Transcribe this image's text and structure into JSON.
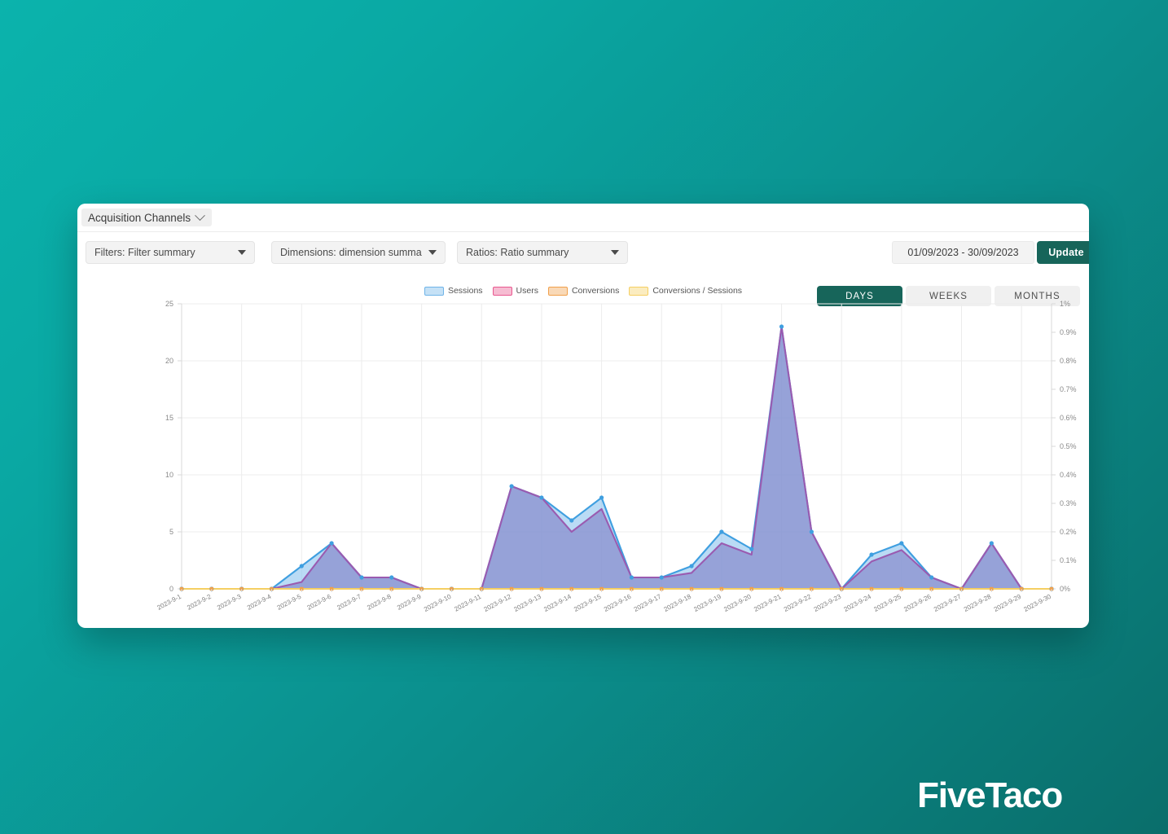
{
  "brand": {
    "name": "FiveTaco"
  },
  "card": {
    "title": "Acquisition Channels",
    "title_icon": "chevron-down-icon"
  },
  "controls": {
    "filters": {
      "label": "Filters: Filter summary",
      "icon": "chevron-down-icon"
    },
    "dimensions": {
      "label": "Dimensions: dimension summary",
      "icon": "chevron-down-icon"
    },
    "ratios": {
      "label": "Ratios: Ratio summary",
      "icon": "chevron-down-icon"
    },
    "date_range": "01/09/2023 - 30/09/2023",
    "update_label": "Update",
    "granularity": [
      {
        "label": "DAYS",
        "active": true
      },
      {
        "label": "WEEKS",
        "active": false
      },
      {
        "label": "MONTHS",
        "active": false
      }
    ]
  },
  "legend": [
    {
      "label": "Sessions",
      "color": "#6fb4e8"
    },
    {
      "label": "Users",
      "color": "#e9588f"
    },
    {
      "label": "Conversions",
      "color": "#f0a04b"
    },
    {
      "label": "Conversions / Sessions",
      "color": "#f5cf62"
    }
  ],
  "chart_data": {
    "type": "area",
    "title": "",
    "xlabel": "",
    "ylabel": "",
    "grid": true,
    "legend_position": "top-center",
    "categories": [
      "2023-9-1",
      "2023-9-2",
      "2023-9-3",
      "2023-9-4",
      "2023-9-5",
      "2023-9-6",
      "2023-9-7",
      "2023-9-8",
      "2023-9-9",
      "2023-9-10",
      "2023-9-11",
      "2023-9-12",
      "2023-9-13",
      "2023-9-14",
      "2023-9-15",
      "2023-9-16",
      "2023-9-17",
      "2023-9-18",
      "2023-9-19",
      "2023-9-20",
      "2023-9-21",
      "2023-9-22",
      "2023-9-23",
      "2023-9-24",
      "2023-9-25",
      "2023-9-26",
      "2023-9-27",
      "2023-9-28",
      "2023-9-29",
      "2023-9-30"
    ],
    "left_axis": {
      "ticks": [
        0,
        5,
        10,
        15,
        20,
        25
      ],
      "ylim": [
        0,
        25
      ],
      "tick_labels": [
        "0",
        "5",
        "10",
        "15",
        "20",
        "25"
      ]
    },
    "right_axis": {
      "ticks": [
        0,
        0.1,
        0.2,
        0.3,
        0.4,
        0.5,
        0.6,
        0.7,
        0.8,
        0.9,
        1
      ],
      "ylim": [
        0,
        1
      ],
      "tick_labels": [
        "0%",
        "0.1%",
        "0.2%",
        "0.3%",
        "0.4%",
        "0.5%",
        "0.6%",
        "0.7%",
        "0.8%",
        "0.9%",
        "1%"
      ]
    },
    "series": [
      {
        "name": "Sessions",
        "color": "#3f9fe0",
        "fill": "#8fc5ef",
        "axis": "left",
        "values": [
          0,
          0,
          0,
          0,
          2,
          4,
          1,
          1,
          0,
          0,
          0,
          9,
          8,
          6,
          8,
          1,
          1,
          2,
          5,
          3.5,
          23,
          5,
          0,
          3,
          4,
          1,
          0,
          4,
          0,
          0
        ]
      },
      {
        "name": "Users",
        "color": "#9a5bb0",
        "fill": "#7f7fc7",
        "axis": "left",
        "values": [
          0,
          0,
          0,
          0,
          0.6,
          4,
          1,
          1,
          0,
          0,
          0,
          9,
          8,
          5,
          7,
          1,
          1,
          1.4,
          4,
          3,
          23,
          5,
          0,
          2.4,
          3.4,
          1,
          0,
          4,
          0,
          0
        ]
      },
      {
        "name": "Conversions",
        "color": "#f0a04b",
        "fill": "none",
        "axis": "left",
        "values": [
          0,
          0,
          0,
          0,
          0,
          0,
          0,
          0,
          0,
          0,
          0,
          0,
          0,
          0,
          0,
          0,
          0,
          0,
          0,
          0,
          0,
          0,
          0,
          0,
          0,
          0,
          0,
          0,
          0,
          0
        ]
      },
      {
        "name": "Conversions / Sessions",
        "color": "#f5cf62",
        "fill": "none",
        "axis": "right",
        "values": [
          0,
          0,
          0,
          0,
          0,
          0,
          0,
          0,
          0,
          0,
          0,
          0,
          0,
          0,
          0,
          0,
          0,
          0,
          0,
          0,
          0,
          0,
          0,
          0,
          0,
          0,
          0,
          0,
          0,
          0
        ]
      }
    ]
  }
}
